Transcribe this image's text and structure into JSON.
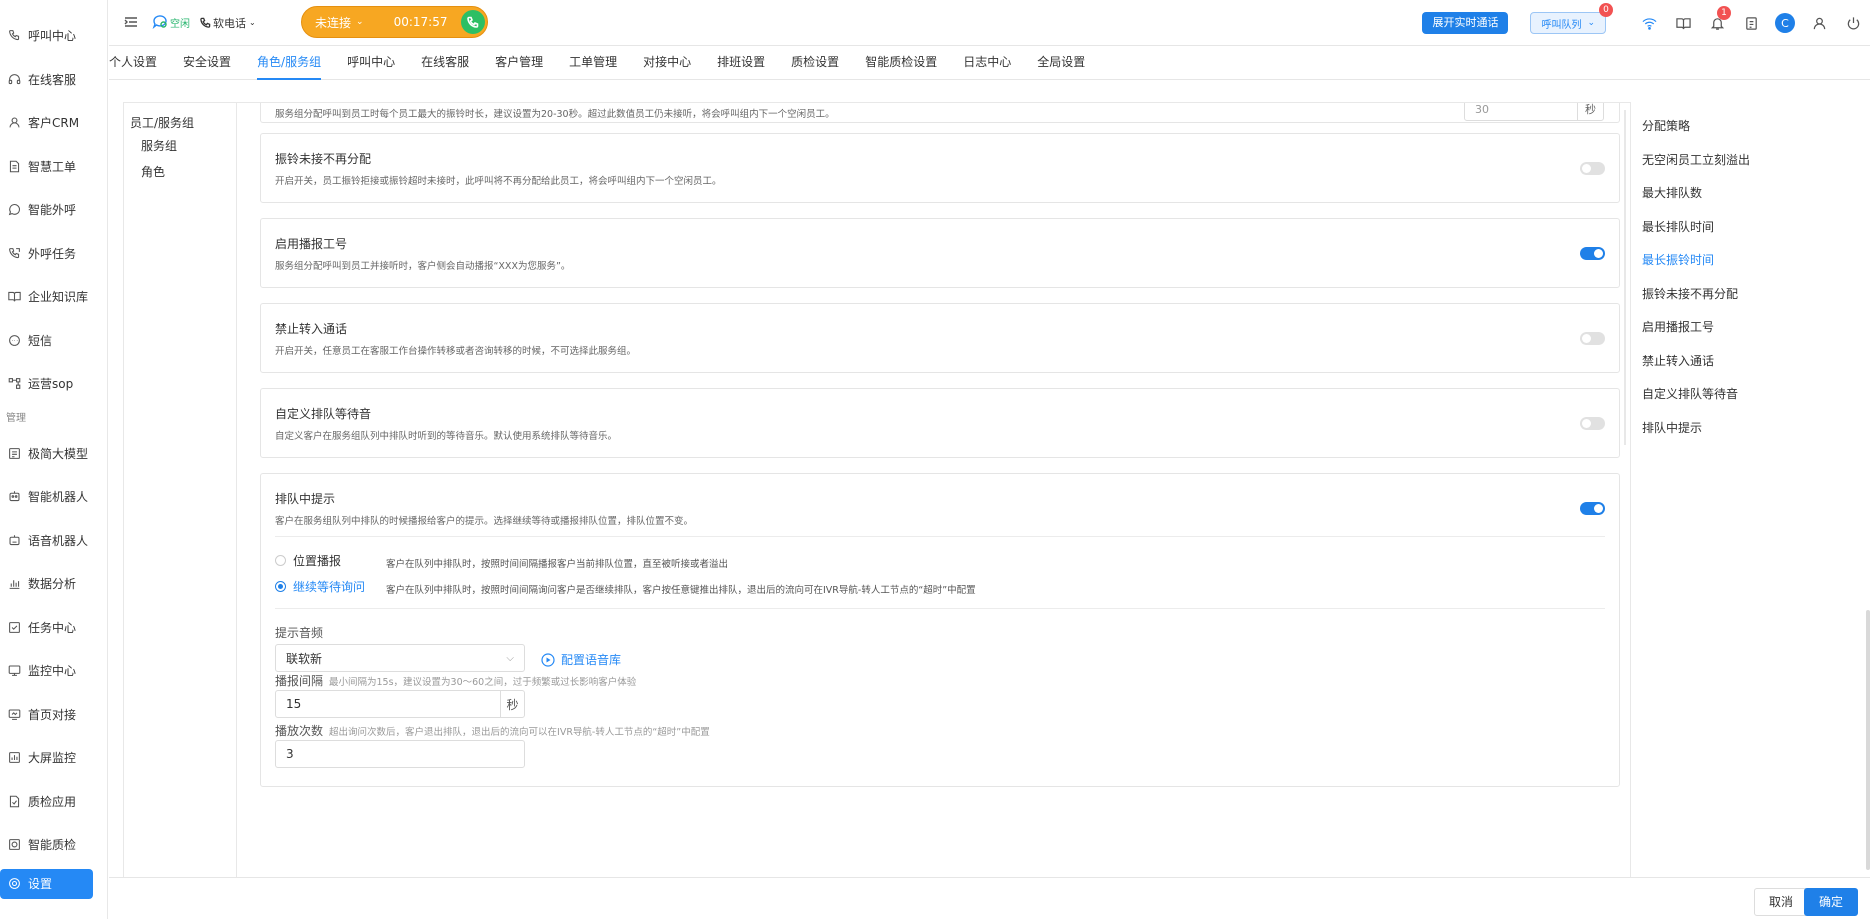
{
  "sidebar": {
    "items": [
      {
        "label": "呼叫中心",
        "icon": "phone-icon"
      },
      {
        "label": "在线客服",
        "icon": "headset-icon"
      },
      {
        "label": "客户CRM",
        "icon": "user-icon"
      },
      {
        "label": "智慧工单",
        "icon": "document-icon"
      },
      {
        "label": "智能外呼",
        "icon": "whatsapp-icon"
      },
      {
        "label": "外呼任务",
        "icon": "phone-forward-icon"
      },
      {
        "label": "企业知识库",
        "icon": "book-icon"
      },
      {
        "label": "短信",
        "icon": "sms-icon"
      },
      {
        "label": "运营sop",
        "icon": "flow-icon"
      }
    ],
    "section_manage": "管理",
    "manage_items": [
      {
        "label": "极简大模型",
        "icon": "model-icon"
      },
      {
        "label": "智能机器人",
        "icon": "robot-icon"
      },
      {
        "label": "语音机器人",
        "icon": "voice-robot-icon"
      },
      {
        "label": "数据分析",
        "icon": "chart-icon"
      },
      {
        "label": "任务中心",
        "icon": "task-icon"
      },
      {
        "label": "监控中心",
        "icon": "monitor-icon"
      },
      {
        "label": "首页对接",
        "icon": "home-link-icon"
      },
      {
        "label": "大屏监控",
        "icon": "screen-icon"
      },
      {
        "label": "质检应用",
        "icon": "inspect-icon"
      },
      {
        "label": "智能质检",
        "icon": "smart-inspect-icon"
      }
    ],
    "active_item": {
      "label": "设置",
      "icon": "settings-icon"
    }
  },
  "topbar": {
    "status": "空闲",
    "phone_mode": "软电话",
    "call_status": "未连接",
    "call_timer": "00:17:57",
    "realtime_button": "展开实时通话",
    "queue_label": "呼叫队列",
    "queue_badge": "0",
    "notification_badge": "1",
    "avatar_letter": "C"
  },
  "tabs": [
    "个人设置",
    "安全设置",
    "角色/服务组",
    "呼叫中心",
    "在线客服",
    "客户管理",
    "工单管理",
    "对接中心",
    "排班设置",
    "质检设置",
    "智能质检设置",
    "日志中心",
    "全局设置"
  ],
  "active_tab": "角色/服务组",
  "tree": {
    "root": "员工/服务组",
    "children": [
      "服务组",
      "角色"
    ]
  },
  "cards": {
    "ring_timeout": {
      "desc": "服务组分配呼叫到员工时每个员工最大的振铃时长，建议设置为20-30秒。超过此数值员工仍未接听，将会呼叫组内下一个空闲员工。",
      "value": "30",
      "unit": "秒"
    },
    "no_reassign": {
      "title": "振铃未接不再分配",
      "desc": "开启开关，员工振铃拒接或振铃超时未接时，此呼叫将不再分配给此员工，将会呼叫组内下一个空闲员工。",
      "enabled": false
    },
    "broadcast_id": {
      "title": "启用播报工号",
      "desc": "服务组分配呼叫到员工并接听时，客户侧会自动播报“XXX为您服务”。",
      "enabled": true
    },
    "no_transfer": {
      "title": "禁止转入通话",
      "desc": "开启开关，任意员工在客服工作台操作转移或者咨询转移的时候，不可选择此服务组。",
      "enabled": false
    },
    "custom_wait": {
      "title": "自定义排队等待音",
      "desc": "自定义客户在服务组队列中排队时听到的等待音乐。默认使用系统排队等待音乐。",
      "enabled": false
    },
    "queue_prompt": {
      "title": "排队中提示",
      "desc": "客户在服务组队列中排队的时候播报给客户的提示。选择继续等待或播报排队位置，排队位置不变。",
      "enabled": true,
      "options": [
        {
          "label": "位置播报",
          "desc": "客户在队列中排队时，按照时间间隔播报客户当前排队位置，直至被听接或者溢出",
          "checked": false
        },
        {
          "label": "继续等待询问",
          "desc": "客户在队列中排队时，按照时间间隔询问客户是否继续排队，客户按任意键推出排队，退出后的流向可在IVR导航-转人工节点的“超时”中配置",
          "checked": true
        }
      ],
      "audio_label": "提示音频",
      "audio_value": "联软新",
      "config_link": "配置语音库",
      "interval_label": "播报间隔",
      "interval_hint": "最小间隔为15s，建议设置为30～60之间，过于频繁或过长影响客户体验",
      "interval_value": "15",
      "interval_unit": "秒",
      "count_label": "播放次数",
      "count_hint": "超出询问次数后，客户退出排队，退出后的流向可以在IVR导航-转人工节点的“超时”中配置",
      "count_value": "3"
    }
  },
  "anchor_nav": {
    "items": [
      "分配策略",
      "无空闲员工立刻溢出",
      "最大排队数",
      "最长排队时间",
      "最长振铃时间",
      "振铃未接不再分配",
      "启用播报工号",
      "禁止转入通话",
      "自定义排队等待音",
      "排队中提示"
    ],
    "active": "最长振铃时间"
  },
  "footer": {
    "cancel": "取消",
    "confirm": "确定"
  },
  "colors": {
    "accent": "#2589f5",
    "call_pill": "#f7a722",
    "answer": "#2dbf64",
    "badge": "#f25252"
  }
}
